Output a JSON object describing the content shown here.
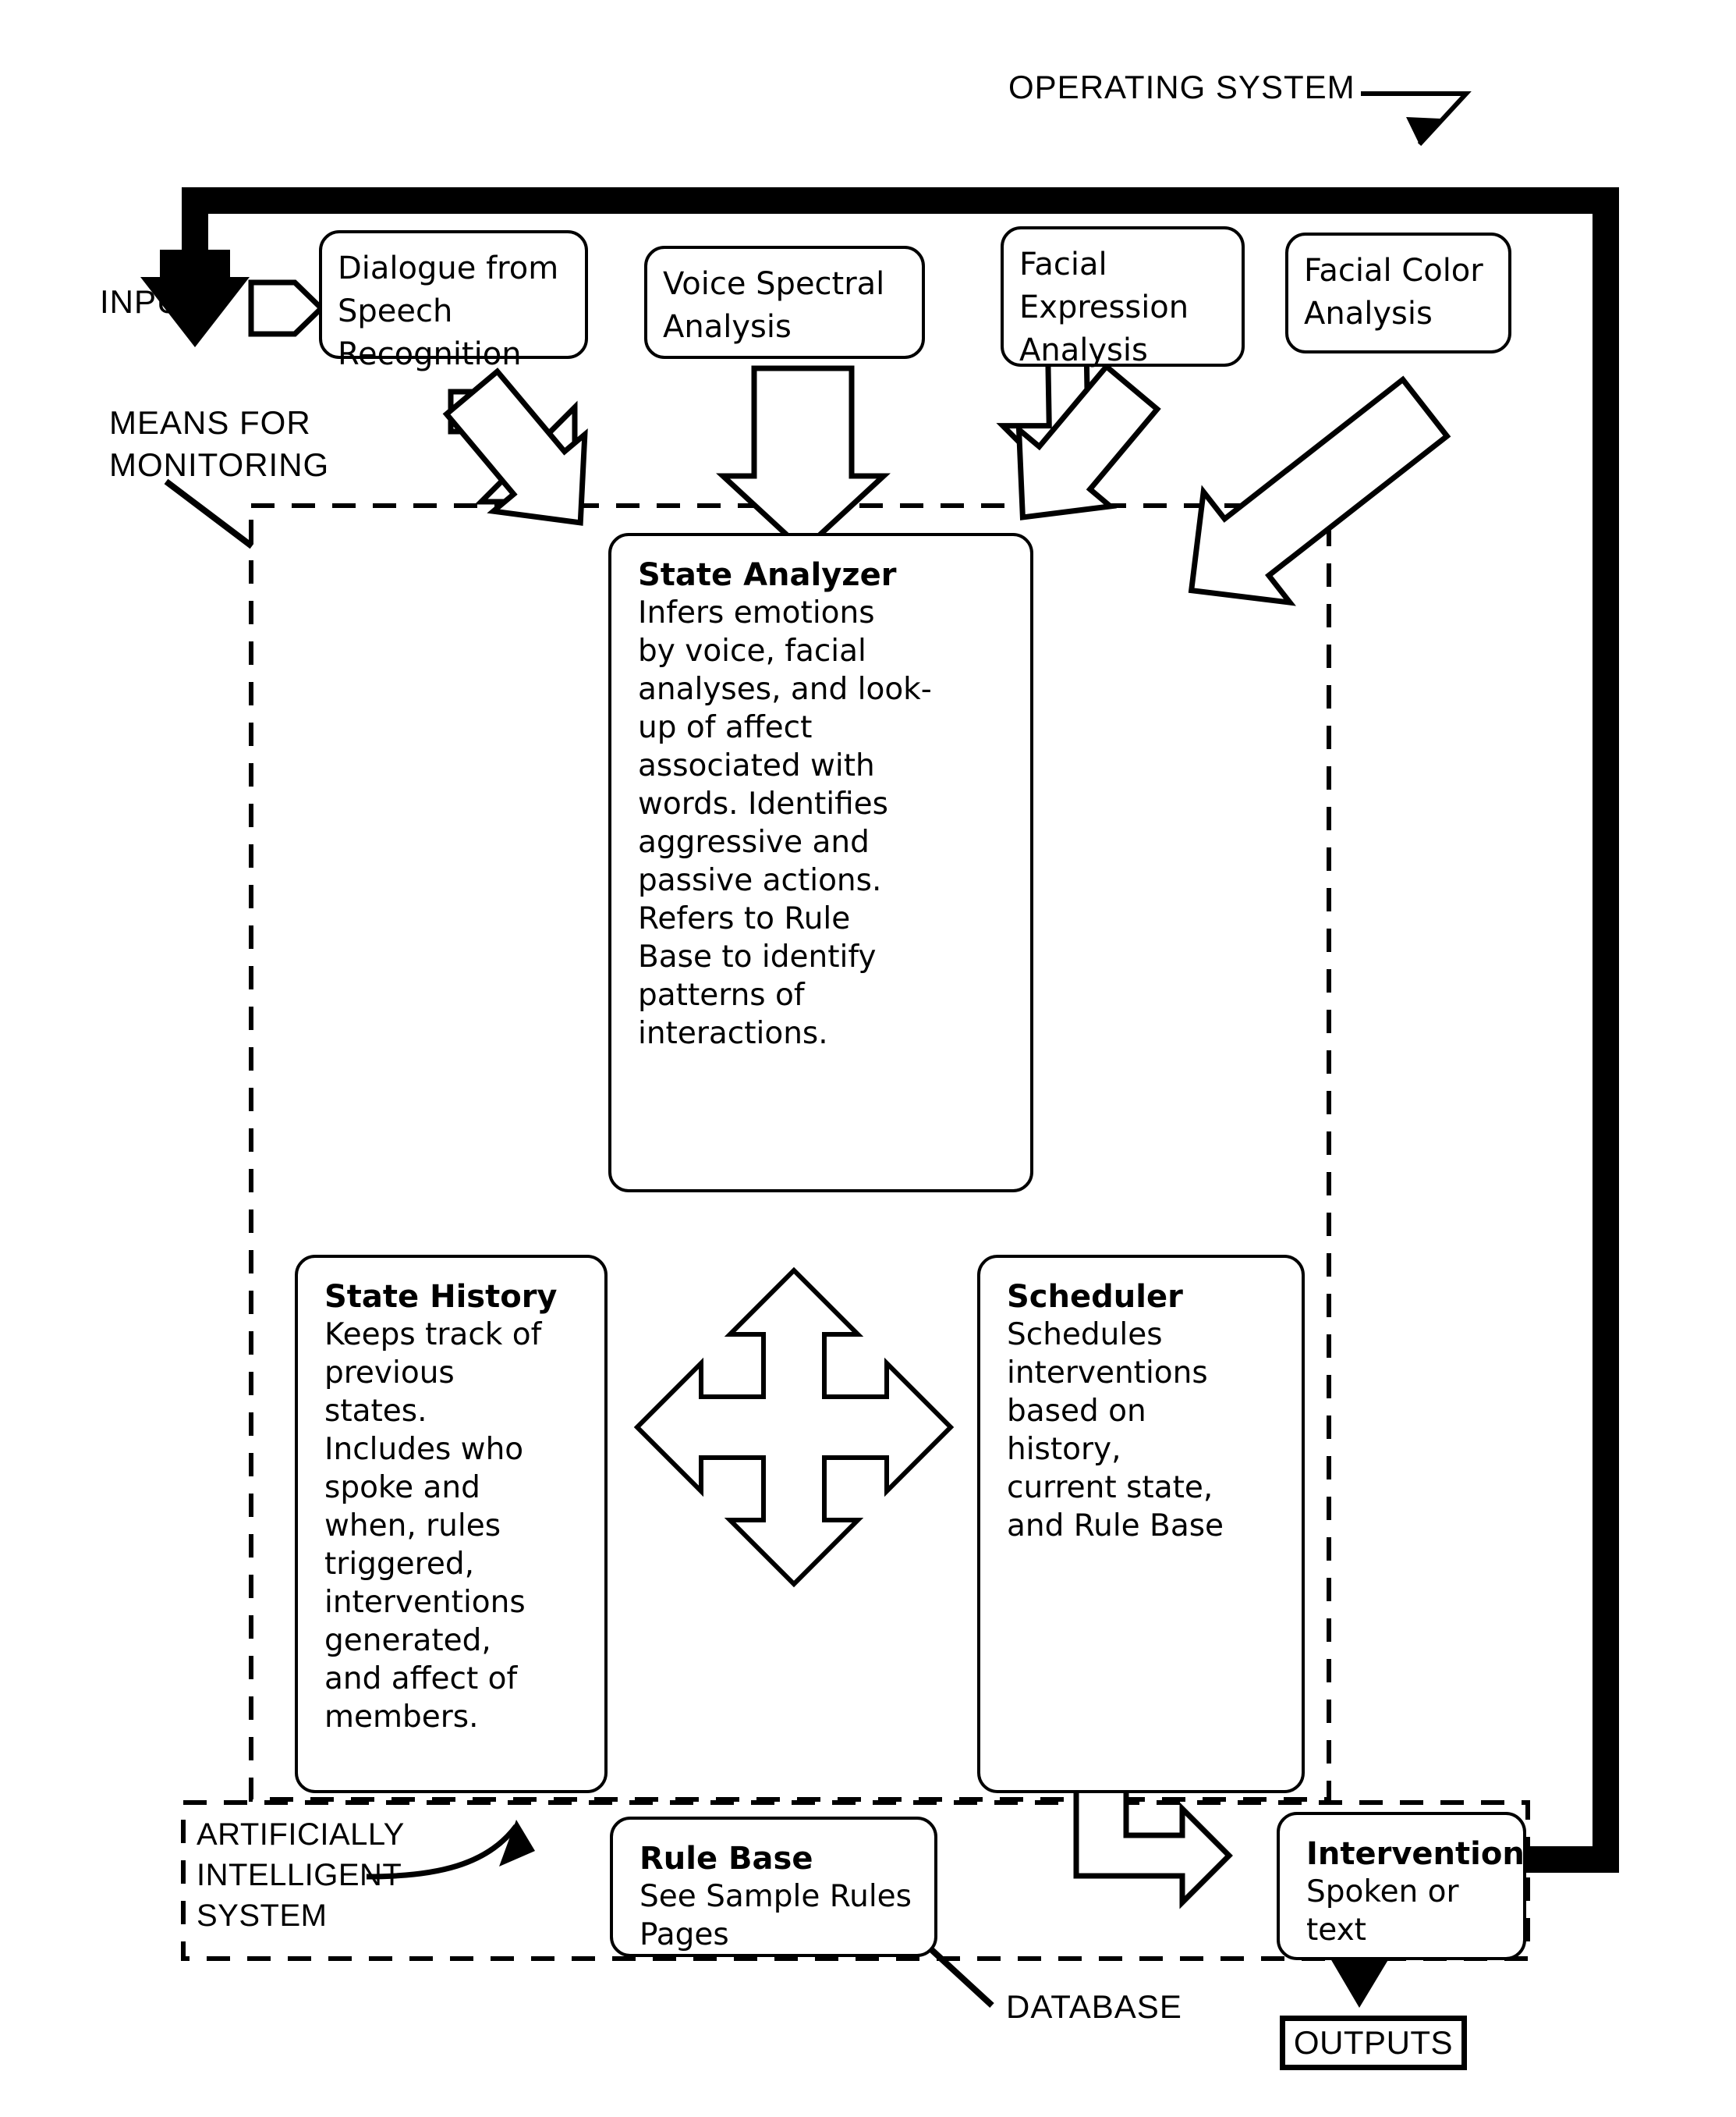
{
  "diagram": {
    "title": "OPERATING SYSTEM",
    "labels": {
      "operating_system": "OPERATING SYSTEM",
      "inputs": "INPUTS",
      "means_for_monitoring": "MEANS FOR\nMONITORING",
      "artificially_intelligent_system": "ARTIFICIALLY\nINTELLIGENT\nSYSTEM",
      "database": "DATABASE",
      "outputs": "OUTPUTS"
    },
    "inputs_row": [
      {
        "id": "dialogue-from-speech-recognition",
        "text": "Dialogue from\nSpeech\nRecognition"
      },
      {
        "id": "voice-spectral-analysis",
        "text": "Voice Spectral\nAnalysis"
      },
      {
        "id": "facial-expression-analysis",
        "text": "Facial\nExpression\nAnalysis"
      },
      {
        "id": "facial-color-analysis",
        "text": "Facial Color\nAnalysis"
      }
    ],
    "modules": [
      {
        "id": "state-analyzer",
        "title": "State Analyzer",
        "body": "Infers emotions\nby voice,  facial\nanalyses, and look-\nup of affect\nassociated with\nwords. Identifies\naggressive and\npassive actions.\nRefers to Rule\nBase to identify\npatterns of\ninteractions."
      },
      {
        "id": "state-history",
        "title": "State History",
        "body": "Keeps track of\nprevious\nstates.\nIncludes who\nspoke and\nwhen, rules\ntriggered,\ninterventions\ngenerated,\nand affect of\nmembers."
      },
      {
        "id": "scheduler",
        "title": "Scheduler",
        "body": "Schedules\ninterventions\nbased on\nhistory,\ncurrent state,\nand Rule Base"
      },
      {
        "id": "rule-base",
        "title": "Rule Base",
        "body": "See Sample Rules\nPages"
      },
      {
        "id": "intervention",
        "title": "Intervention",
        "body": "Spoken or\ntext"
      }
    ],
    "colors": {
      "ink": "#000000",
      "paper": "#ffffff"
    }
  }
}
